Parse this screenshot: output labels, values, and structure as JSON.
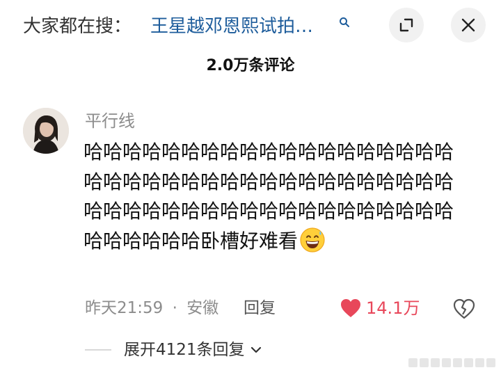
{
  "search_bar": {
    "prefix": "大家都在搜：",
    "query": "王星越邓恩熙试拍…"
  },
  "header": {
    "comment_count": "2.0万条评论"
  },
  "comment": {
    "username": "平行线",
    "text": "哈哈哈哈哈哈哈哈哈哈哈哈哈哈哈哈哈哈哈哈哈哈哈哈哈哈哈哈哈哈哈哈哈哈哈哈哈哈哈哈哈哈哈哈哈哈哈哈哈哈哈哈哈哈哈哈哈哈哈哈哈哈哈卧槽好难看",
    "emoji": "grinning-sweat-emoji",
    "time": "昨天21:59",
    "separator": "·",
    "location": "安徽",
    "reply_label": "回复",
    "like_count": "14.1万",
    "liked": true
  },
  "replies": {
    "expand_label": "展开4121条回复"
  },
  "colors": {
    "link": "#1d5c9b",
    "like": "#e8475a",
    "muted": "#8c8c8c"
  }
}
